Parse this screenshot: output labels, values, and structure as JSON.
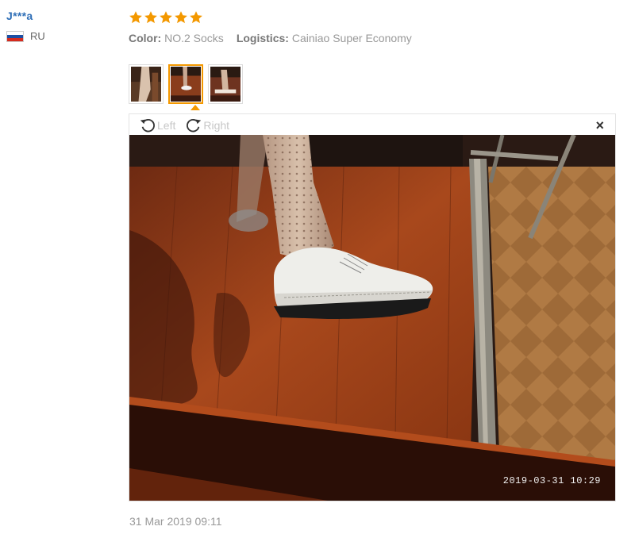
{
  "user": {
    "name": "J***a",
    "country": "RU",
    "flag_colors": [
      "#ffffff",
      "#1d4fa3",
      "#d52b1e"
    ]
  },
  "review": {
    "rating": 5,
    "star_color": "#f39800",
    "color_label": "Color:",
    "color_value": "NO.2 Socks",
    "logistics_label": "Logistics:",
    "logistics_value": "Cainiao Super Economy",
    "date": "31 Mar 2019 09:11"
  },
  "gallery": {
    "thumbnail_count": 3,
    "active_index": 1
  },
  "viewer": {
    "rotate_left_label": "Left",
    "rotate_right_label": "Right",
    "close_symbol": "×",
    "photo_timestamp": "2019-03-31  10:29"
  }
}
